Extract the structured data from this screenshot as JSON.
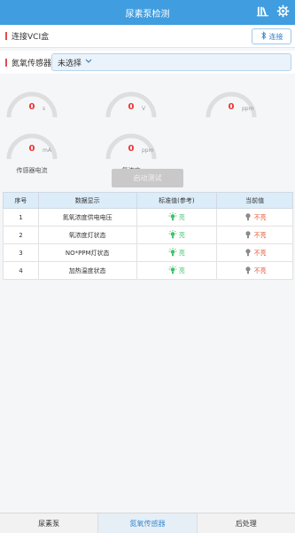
{
  "header": {
    "title": "尿素泵检测",
    "icons": [
      "library-icon",
      "gear-icon"
    ]
  },
  "vci": {
    "label": "连接VCI盒",
    "button": "连接"
  },
  "sensor": {
    "label": "氮氧传感器:",
    "selected": "未选择"
  },
  "gauges": [
    {
      "value": "0",
      "unit": "s"
    },
    {
      "value": "0",
      "unit": "V"
    },
    {
      "value": "0",
      "unit": "ppm"
    },
    {
      "value": "0",
      "unit": "mA",
      "caption": "传感器电流"
    },
    {
      "value": "0",
      "unit": "ppm",
      "caption": "氧浓度"
    }
  ],
  "start_button": "启动测试",
  "table": {
    "headers": [
      "序号",
      "数据显示",
      "标准值(参考)",
      "当前值"
    ],
    "rows": [
      {
        "no": "1",
        "name": "氮氧浓度供电电压",
        "standard": "亮",
        "current": "不亮"
      },
      {
        "no": "2",
        "name": "氧浓度灯状态",
        "standard": "亮",
        "current": "不亮"
      },
      {
        "no": "3",
        "name": "NO*PPM灯状态",
        "standard": "亮",
        "current": "不亮"
      },
      {
        "no": "4",
        "name": "加热温度状态",
        "standard": "亮",
        "current": "不亮"
      }
    ]
  },
  "tabs": [
    "尿素泵",
    "氮氧传感器",
    "后处理"
  ],
  "colors": {
    "header": "#3f9de0",
    "bulb_on": "#3cc26a",
    "bulb_off": "#8a8a8a",
    "value_red": "#e33"
  }
}
